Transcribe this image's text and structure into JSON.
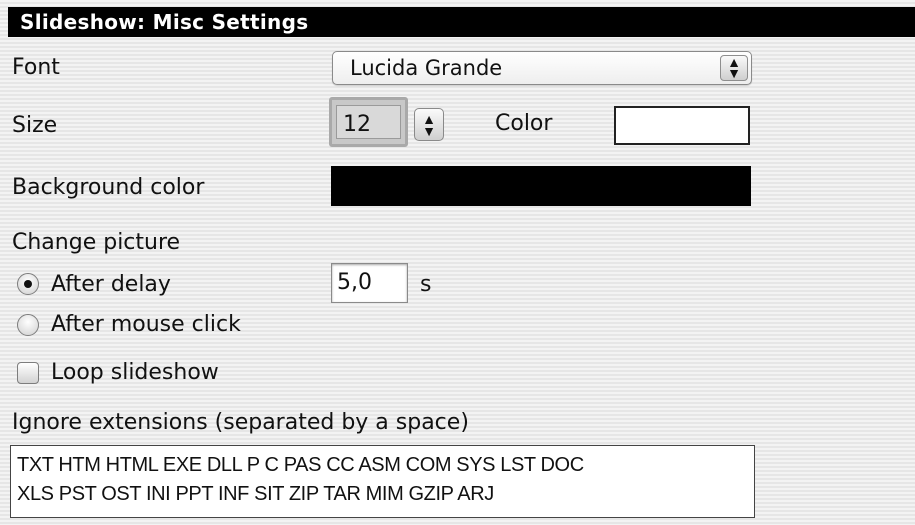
{
  "window": {
    "title": "Slideshow: Misc Settings"
  },
  "font": {
    "label": "Font",
    "value": "Lucida Grande"
  },
  "size": {
    "label": "Size",
    "value": "12"
  },
  "color": {
    "label": "Color",
    "value": "#ffffff"
  },
  "background_color": {
    "label": "Background color",
    "value": "#000000"
  },
  "change_picture": {
    "label": "Change picture",
    "options": [
      {
        "label": "After delay",
        "selected": true
      },
      {
        "label": "After mouse click",
        "selected": false
      }
    ],
    "delay_value": "5,0",
    "delay_unit": "s"
  },
  "loop": {
    "label": "Loop slideshow",
    "checked": false
  },
  "ignore_extensions": {
    "label": "Ignore extensions (separated by a space)",
    "lines": [
      "TXT HTM HTML EXE DLL P C PAS CC ASM COM SYS LST DOC",
      "XLS PST OST INI PPT INF SIT ZIP TAR MIM GZIP ARJ"
    ]
  },
  "icons": {
    "popup": "up-down-arrows-icon",
    "stepper": "up-down-arrows-icon"
  }
}
